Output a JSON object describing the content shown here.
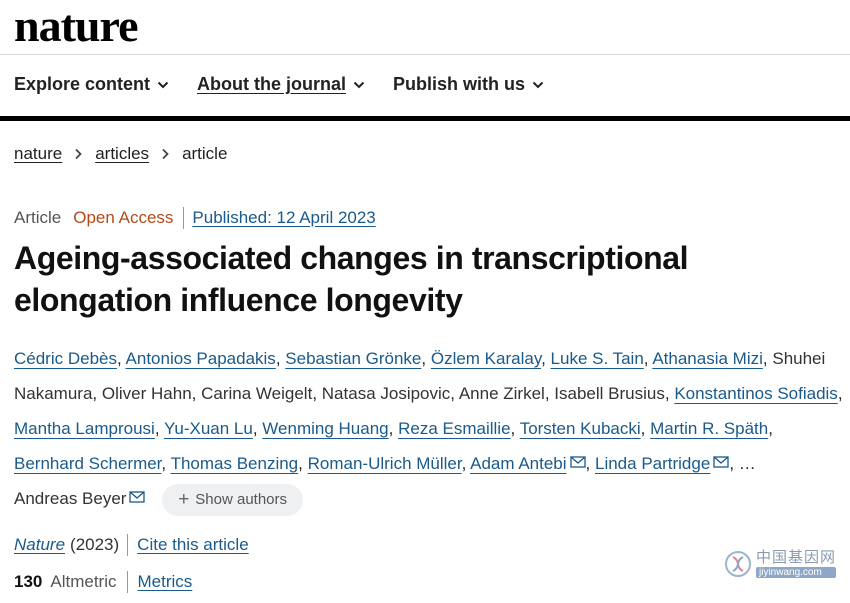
{
  "header": {
    "logo": "nature"
  },
  "nav": {
    "items": [
      {
        "label": "Explore content"
      },
      {
        "label": "About the journal"
      },
      {
        "label": "Publish with us"
      }
    ]
  },
  "breadcrumb": {
    "items": [
      "nature",
      "articles"
    ],
    "current": "article"
  },
  "article": {
    "type": "Article",
    "access": "Open Access",
    "published": "Published: 12 April 2023",
    "title_line1": "Ageing-associated changes in transcriptional",
    "title_line2": "elongation influence longevity"
  },
  "authors": {
    "names": [
      "Cédric Debès",
      "Antonios Papadakis",
      "Sebastian Grönke",
      "Özlem Karalay",
      "Luke S. Tain",
      "Athanasia Mizi",
      "Shuhei Nakamura",
      "Oliver Hahn",
      "Carina Weigelt",
      "Natasa Josipovic",
      "Anne Zirkel",
      "Isabell Brusius",
      "Konstantinos Sofiadis",
      "Mantha Lamprousi",
      "Yu-Xuan Lu",
      "Wenming Huang",
      "Reza Esmaillie",
      "Torsten Kubacki",
      "Martin R. Späth",
      "Bernhard Schermer",
      "Thomas Benzing",
      "Roman-Ulrich Müller",
      "Adam Antebi",
      "Linda Partridge",
      "Andreas Beyer"
    ],
    "separator": ",",
    "ellipsis": "…",
    "show_authors": "Show authors"
  },
  "citation": {
    "journal": "Nature",
    "year": "(2023)",
    "cite": "Cite this article"
  },
  "metrics": {
    "altmetric_value": "130",
    "altmetric_label": "Altmetric",
    "metrics_link": "Metrics"
  },
  "watermark": {
    "text_cn": "中国基因网",
    "url": "jiyinwang.com"
  },
  "colors": {
    "link": "#1b5a8a",
    "open_access": "#b34a1b",
    "rule": "#000000"
  }
}
